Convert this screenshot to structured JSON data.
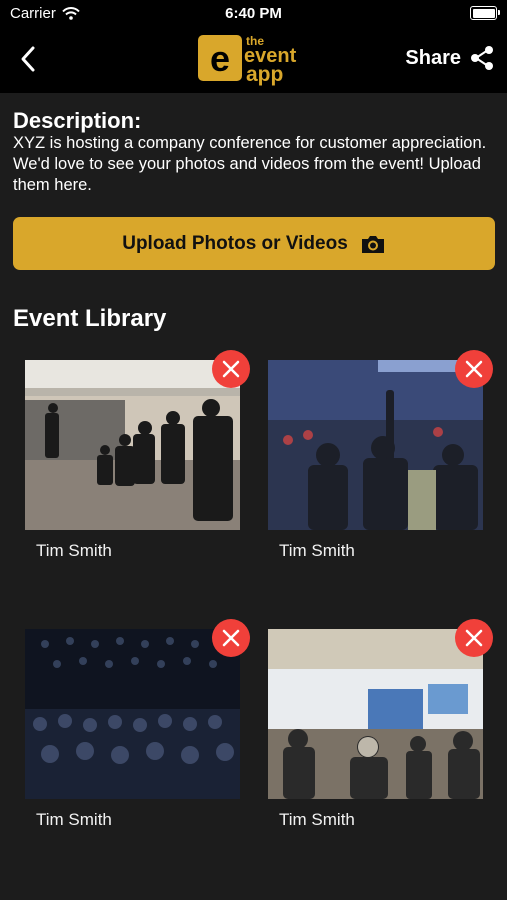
{
  "status_bar": {
    "carrier": "Carrier",
    "time": "6:40 PM"
  },
  "header": {
    "back_icon": "chevron-left-icon",
    "logo": {
      "the": "the",
      "event": "event",
      "app": "app"
    },
    "share_label": "Share",
    "share_icon": "share-icon"
  },
  "description": {
    "title": "Description:",
    "text": "XYZ is hosting a company conference for customer appreciation. We'd love to see your photos and videos from the event! Upload them here."
  },
  "upload_button": {
    "label": "Upload Photos or Videos",
    "icon": "camera-icon"
  },
  "library": {
    "title": "Event Library",
    "items": [
      {
        "author": "Tim Smith"
      },
      {
        "author": "Tim Smith"
      },
      {
        "author": "Tim Smith"
      },
      {
        "author": "Tim Smith"
      }
    ]
  },
  "colors": {
    "accent": "#d9a72b",
    "delete": "#f0403a",
    "background": "#1c1c1c",
    "header": "#000000"
  }
}
